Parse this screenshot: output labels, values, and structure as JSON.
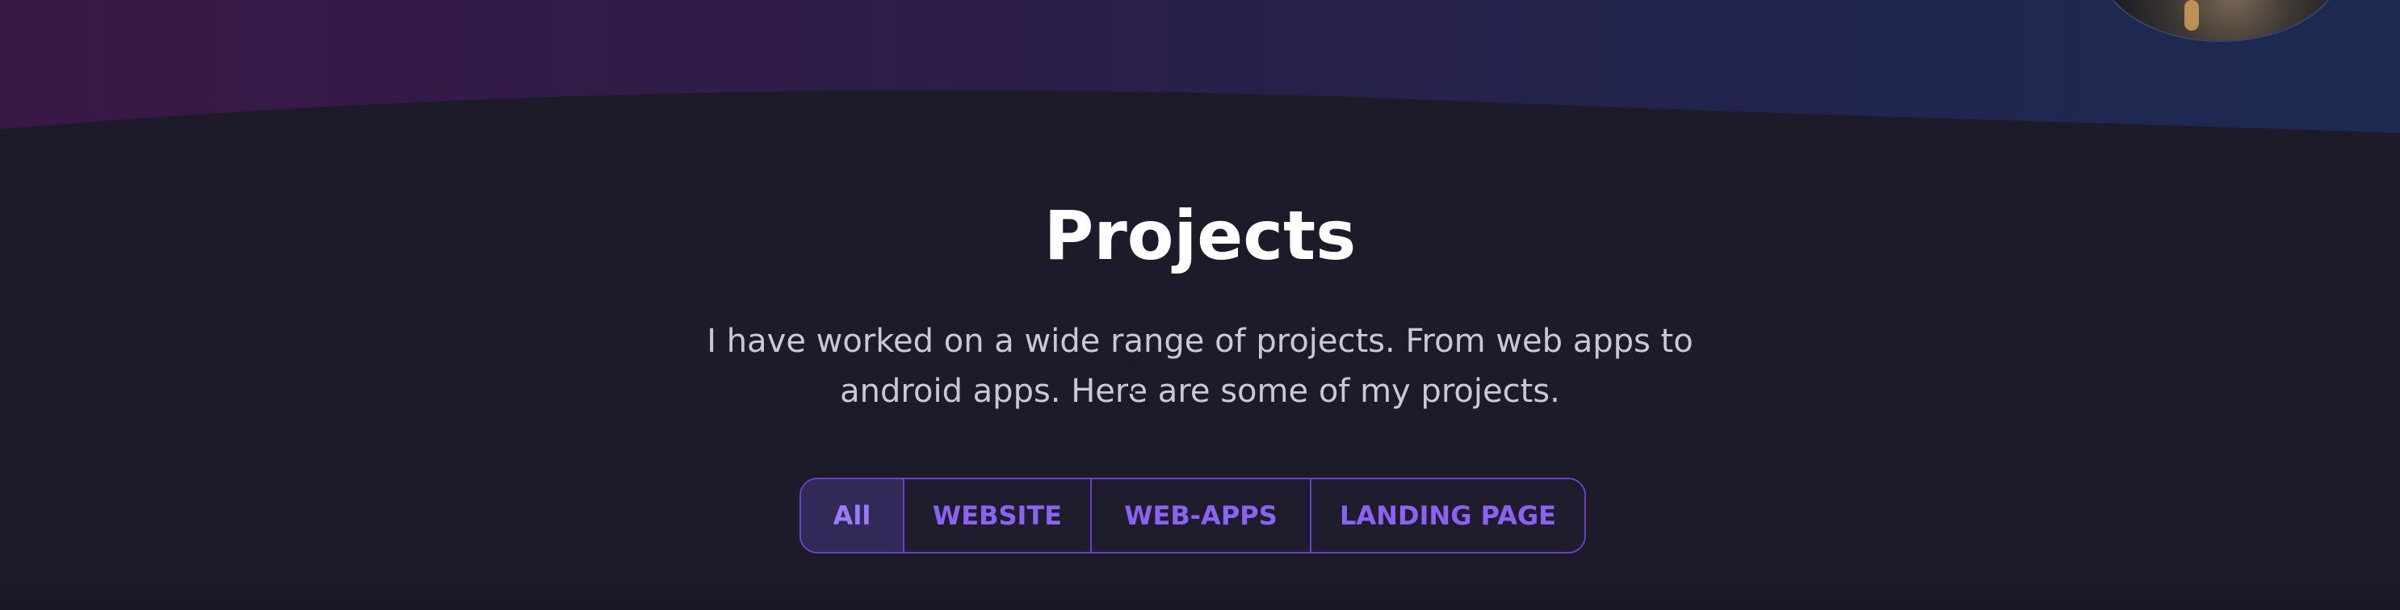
{
  "header": {
    "avatar_icon": "profile-avatar-icon"
  },
  "projects": {
    "title": "Projects",
    "description": "I have worked on a wide range of projects. From web apps to android apps. Here are some of my projects.",
    "filters": [
      {
        "label": "All",
        "active": true
      },
      {
        "label": "WEBSITE",
        "active": false
      },
      {
        "label": "WEB-APPS",
        "active": false
      },
      {
        "label": "LANDING PAGE",
        "active": false
      }
    ]
  },
  "colors": {
    "background": "#1D1B29",
    "header_gradient_start": "#3A1846",
    "header_gradient_end": "#1D2A52",
    "accent": "#8B63F2",
    "accent_border": "#6A42C9",
    "active_filter_bg": "#312A59",
    "title_text": "#FFFFFF",
    "body_text": "#C9C9D3"
  },
  "icons": {
    "cursor": "text-cursor-icon"
  }
}
